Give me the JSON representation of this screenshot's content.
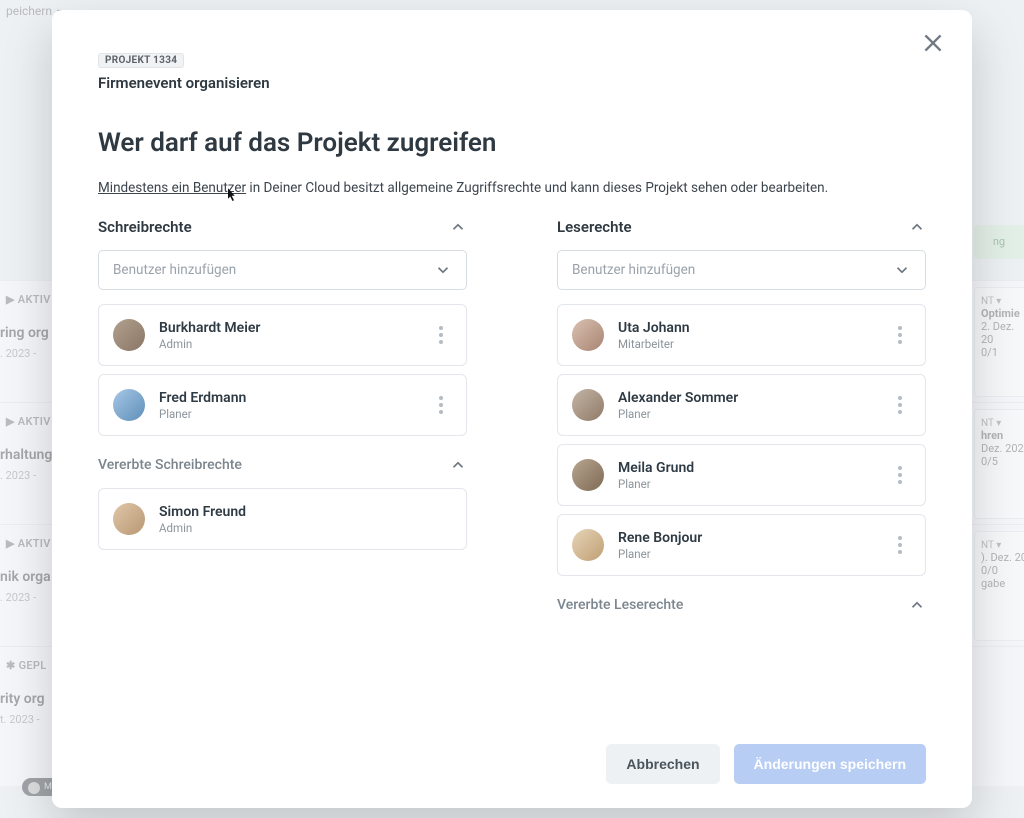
{
  "background": {
    "save_label": "peichern",
    "group1_tag": "AKTIV",
    "group1_title": "ring org",
    "group1_date": ". 2023 -",
    "group2_tag": "AKTIV",
    "group2_title": "rhaltung",
    "group2_date": ". 2023 -",
    "group3_tag": "AKTIV",
    "group3_title": "nik orga",
    "group3_date": ". 2023 -",
    "group4_tag": "GEPL",
    "group4_title": "rity org",
    "group4_date": "t. 2023 -",
    "green_label": "ng",
    "right1_title": "Optimie",
    "right1_date": "2. Dez. 20",
    "right1_meta": "0/1",
    "right2_title": "hren",
    "right2_date": "Dez. 202",
    "right2_meta": "0/5",
    "right3_date": "). Dez. 20",
    "right3_meta": "0/0",
    "right3_sub": "gabe",
    "madewith": "MADE WITH GIFOX"
  },
  "modal": {
    "badge": "PROJEKT 1334",
    "project_title": "Firmenevent organisieren",
    "heading": "Wer darf auf das Projekt zugreifen",
    "info_link": "Mindestens ein Benutzer",
    "info_rest": " in Deiner Cloud besitzt allgemeine Zugriffsrechte und kann dieses Projekt sehen oder bearbeiten.",
    "write": {
      "title": "Schreibrechte",
      "add_placeholder": "Benutzer hinzufügen",
      "users": [
        {
          "name": "Burkhardt Meier",
          "role": "Admin",
          "avatar": "av1"
        },
        {
          "name": "Fred Erdmann",
          "role": "Planer",
          "avatar": "av2"
        }
      ],
      "inherited_title": "Vererbte Schreibrechte",
      "inherited_users": [
        {
          "name": "Simon Freund",
          "role": "Admin",
          "avatar": "av3"
        }
      ]
    },
    "read": {
      "title": "Leserechte",
      "add_placeholder": "Benutzer hinzufügen",
      "users": [
        {
          "name": "Uta Johann",
          "role": "Mitarbeiter",
          "avatar": "av4"
        },
        {
          "name": "Alexander Sommer",
          "role": "Planer",
          "avatar": "av5"
        },
        {
          "name": "Meila Grund",
          "role": "Planer",
          "avatar": "av6"
        },
        {
          "name": "Rene Bonjour",
          "role": "Planer",
          "avatar": "av7"
        }
      ],
      "inherited_title": "Vererbte Leserechte"
    },
    "footer": {
      "cancel": "Abbrechen",
      "save": "Änderungen speichern"
    }
  }
}
